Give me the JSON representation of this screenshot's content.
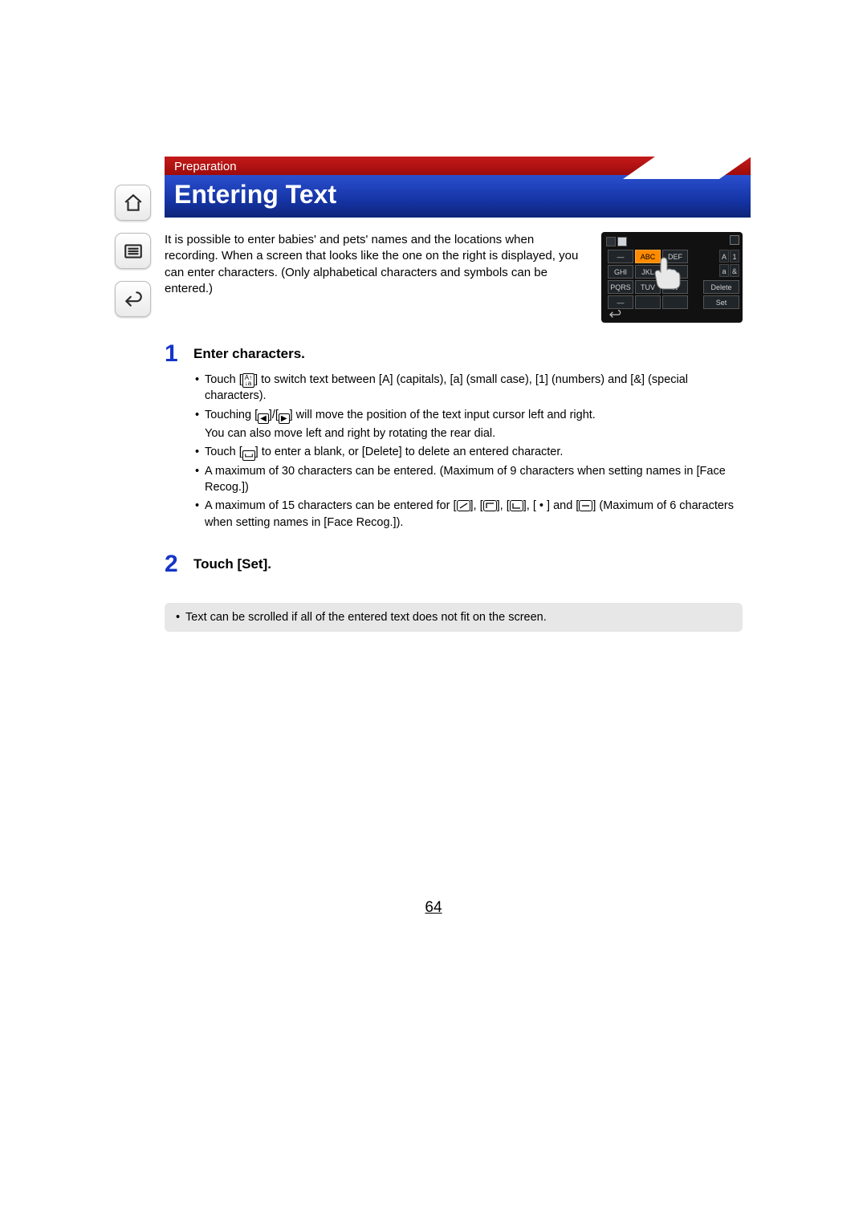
{
  "header": {
    "section": "Preparation",
    "title": "Entering Text"
  },
  "intro": "It is possible to enter babies' and pets' names and the locations when recording. When a screen that looks like the one on the right is displayed, you can enter characters. (Only alphabetical characters and symbols can be entered.)",
  "thumb": {
    "r1": [
      "—",
      "ABC",
      "DEF"
    ],
    "r2": [
      "GHI",
      "JKL",
      ""
    ],
    "r3": [
      "PQRS",
      "TUV",
      "W"
    ],
    "r4": [
      "—",
      "",
      ""
    ],
    "right_top": [
      "A",
      "1"
    ],
    "right_bot": [
      "a",
      "&"
    ],
    "delete": "Delete",
    "set": "Set",
    "mode": ""
  },
  "steps": [
    {
      "num": "1",
      "title": "Enter characters.",
      "bullets": [
        {
          "pre": "Touch [",
          "iconName": "mode-switch-icon",
          "iconText": "A↑\n↓a",
          "post": "] to switch text between [A] (capitals), [a] (small case), [1] (numbers) and [&] (special characters)."
        },
        {
          "text": "Touching [◀]/[▶] will move the position of the text input cursor left and right.",
          "sub": "You can also move left and right by rotating the rear dial.",
          "hasLR": true
        },
        {
          "pre": "Touch [",
          "iconName": "space-icon",
          "iconSvg": "space",
          "post": "] to enter a blank, or [Delete] to delete an entered character."
        },
        {
          "text": "A maximum of 30 characters can be entered. (Maximum of 9 characters when setting names in [Face Recog.])"
        },
        {
          "pre": "A maximum of 15 characters can be entered for [",
          "shapes": true,
          "post": "6 characters when setting names in [Face Recog.])."
        }
      ]
    },
    {
      "num": "2",
      "title": "Touch [Set]."
    }
  ],
  "note": "Text can be scrolled if all of the entered text does not fit on the screen.",
  "pagenum": "64"
}
